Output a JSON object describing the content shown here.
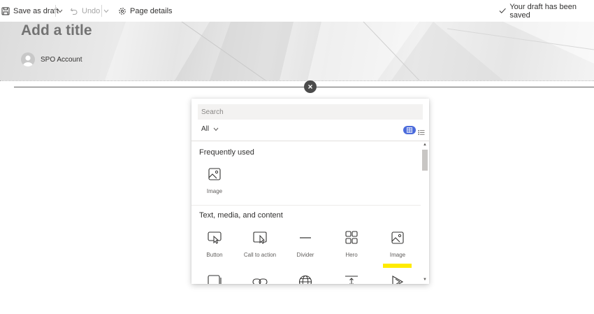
{
  "toolbar": {
    "save_label": "Save as draft",
    "undo_label": "Undo",
    "page_details_label": "Page details",
    "status_text": "Your draft has been saved"
  },
  "hero": {
    "title_placeholder": "Add a title",
    "author_name": "SPO Account"
  },
  "picker": {
    "search_placeholder": "Search",
    "filter_label": "All",
    "sections": [
      {
        "heading": "Frequently used",
        "items": [
          {
            "label": "Image",
            "icon": "image-icon"
          }
        ]
      },
      {
        "heading": "Text, media, and content",
        "items": [
          {
            "label": "Button",
            "icon": "button-icon"
          },
          {
            "label": "Call to action",
            "icon": "call-to-action-icon"
          },
          {
            "label": "Divider",
            "icon": "divider-icon"
          },
          {
            "label": "Hero",
            "icon": "hero-icon"
          },
          {
            "label": "Image",
            "icon": "image-icon"
          }
        ]
      }
    ],
    "partial_row_icons": [
      "image-gallery-icon",
      "link-icon",
      "globe-icon",
      "spacer-icon",
      "stream-icon"
    ]
  },
  "colors": {
    "accent": "#4b6bdb",
    "highlight": "#ffeb00",
    "text": "#323130"
  }
}
